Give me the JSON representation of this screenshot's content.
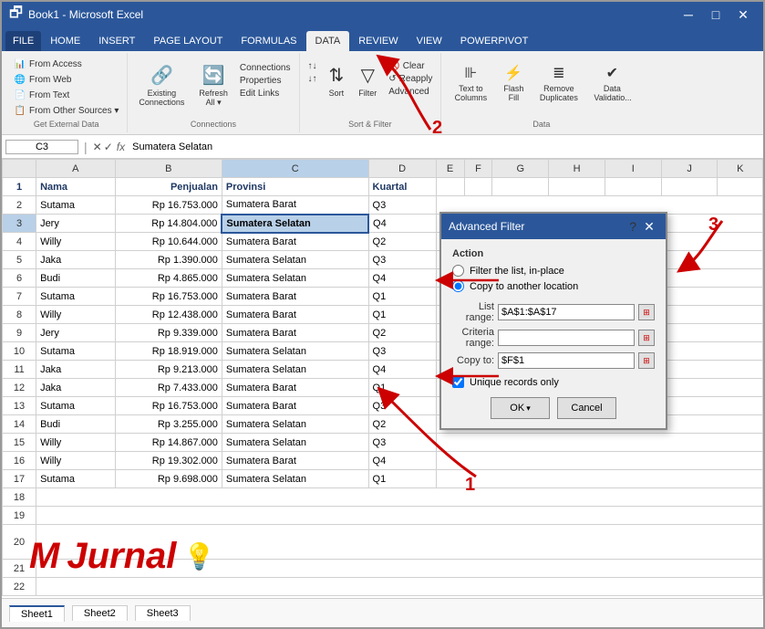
{
  "window": {
    "title": "Microsoft Excel",
    "filename": "Book1 - Microsoft Excel"
  },
  "ribbon_tabs": [
    {
      "label": "FILE",
      "active": false
    },
    {
      "label": "HOME",
      "active": false
    },
    {
      "label": "INSERT",
      "active": false
    },
    {
      "label": "PAGE LAYOUT",
      "active": false
    },
    {
      "label": "FORMULAS",
      "active": false
    },
    {
      "label": "DATA",
      "active": true
    },
    {
      "label": "REVIEW",
      "active": false
    },
    {
      "label": "VIEW",
      "active": false
    },
    {
      "label": "POWERPIVOT",
      "active": false
    }
  ],
  "ribbon_groups": {
    "get_external": {
      "label": "Get External Data",
      "items": [
        "From Access",
        "From Web",
        "From Text",
        "From Other Sources ▾",
        "Existing Connections",
        "Refresh All ▾"
      ]
    },
    "connections": {
      "label": "Connections",
      "items": [
        "Connections",
        "Properties",
        "Edit Links"
      ]
    },
    "sort_filter": {
      "label": "Sort & Filter",
      "items": [
        "Sort",
        "Filter",
        "Clear",
        "Reapply",
        "Advanced"
      ]
    },
    "data_tools": {
      "label": "Data",
      "items": [
        "Text to Columns",
        "Flash Fill",
        "Remove Duplicates",
        "Data Validation"
      ]
    }
  },
  "formula_bar": {
    "cell_ref": "C3",
    "formula": "Sumatera Selatan"
  },
  "columns": [
    "",
    "A",
    "B",
    "C",
    "D",
    "E",
    "F",
    "G",
    "H",
    "I",
    "J",
    "K"
  ],
  "header_row": {
    "cells": [
      "",
      "Nama",
      "Penjualan",
      "Provinsi",
      "Kuartal",
      "",
      "",
      "",
      "",
      "",
      "",
      ""
    ]
  },
  "data_rows": [
    {
      "num": 2,
      "nama": "Sutama",
      "penjualan": "Rp 16.753.000",
      "provinsi": "Sumatera Barat",
      "kuartal": "Q3"
    },
    {
      "num": 3,
      "nama": "Jery",
      "penjualan": "Rp 14.804.000",
      "provinsi": "Sumatera Selatan",
      "kuartal": "Q4"
    },
    {
      "num": 4,
      "nama": "Willy",
      "penjualan": "Rp 10.644.000",
      "provinsi": "Sumatera Barat",
      "kuartal": "Q2"
    },
    {
      "num": 5,
      "nama": "Jaka",
      "penjualan": "Rp  1.390.000",
      "provinsi": "Sumatera Selatan",
      "kuartal": "Q3"
    },
    {
      "num": 6,
      "nama": "Budi",
      "penjualan": "Rp  4.865.000",
      "provinsi": "Sumatera Selatan",
      "kuartal": "Q4"
    },
    {
      "num": 7,
      "nama": "Sutama",
      "penjualan": "Rp 16.753.000",
      "provinsi": "Sumatera Barat",
      "kuartal": "Q1"
    },
    {
      "num": 8,
      "nama": "Willy",
      "penjualan": "Rp 12.438.000",
      "provinsi": "Sumatera Barat",
      "kuartal": "Q1"
    },
    {
      "num": 9,
      "nama": "Jery",
      "penjualan": "Rp  9.339.000",
      "provinsi": "Sumatera Barat",
      "kuartal": "Q2"
    },
    {
      "num": 10,
      "nama": "Sutama",
      "penjualan": "Rp 18.919.000",
      "provinsi": "Sumatera Selatan",
      "kuartal": "Q3"
    },
    {
      "num": 11,
      "nama": "Jaka",
      "penjualan": "Rp  9.213.000",
      "provinsi": "Sumatera Selatan",
      "kuartal": "Q4"
    },
    {
      "num": 12,
      "nama": "Jaka",
      "penjualan": "Rp  7.433.000",
      "provinsi": "Sumatera Barat",
      "kuartal": "Q1"
    },
    {
      "num": 13,
      "nama": "Sutama",
      "penjualan": "Rp 16.753.000",
      "provinsi": "Sumatera Barat",
      "kuartal": "Q3"
    },
    {
      "num": 14,
      "nama": "Budi",
      "penjualan": "Rp  3.255.000",
      "provinsi": "Sumatera Selatan",
      "kuartal": "Q2"
    },
    {
      "num": 15,
      "nama": "Willy",
      "penjualan": "Rp 14.867.000",
      "provinsi": "Sumatera Selatan",
      "kuartal": "Q3"
    },
    {
      "num": 16,
      "nama": "Willy",
      "penjualan": "Rp 19.302.000",
      "provinsi": "Sumatera Barat",
      "kuartal": "Q4"
    },
    {
      "num": 17,
      "nama": "Sutama",
      "penjualan": "Rp  9.698.000",
      "provinsi": "Sumatera Selatan",
      "kuartal": "Q1"
    },
    {
      "num": 18
    },
    {
      "num": 19
    },
    {
      "num": 20
    },
    {
      "num": 21
    },
    {
      "num": 22
    }
  ],
  "dialog": {
    "title": "Advanced Filter",
    "action_label": "Action",
    "radio_option1": "Filter the list, in-place",
    "radio_option2": "Copy to another location",
    "list_range_label": "List range:",
    "list_range_value": "$A$1:$A$17",
    "criteria_range_label": "Criteria range:",
    "criteria_range_value": "",
    "copy_to_label": "Copy to:",
    "copy_to_value": "$F$1",
    "unique_records_label": "Unique records only",
    "ok_label": "OK",
    "cancel_label": "Cancel"
  },
  "branding": {
    "m": "M",
    "jurnal": "Jurnal",
    "bulb": "💡"
  },
  "arrow_labels": {
    "num1": "1",
    "num2": "2",
    "num3": "3"
  }
}
